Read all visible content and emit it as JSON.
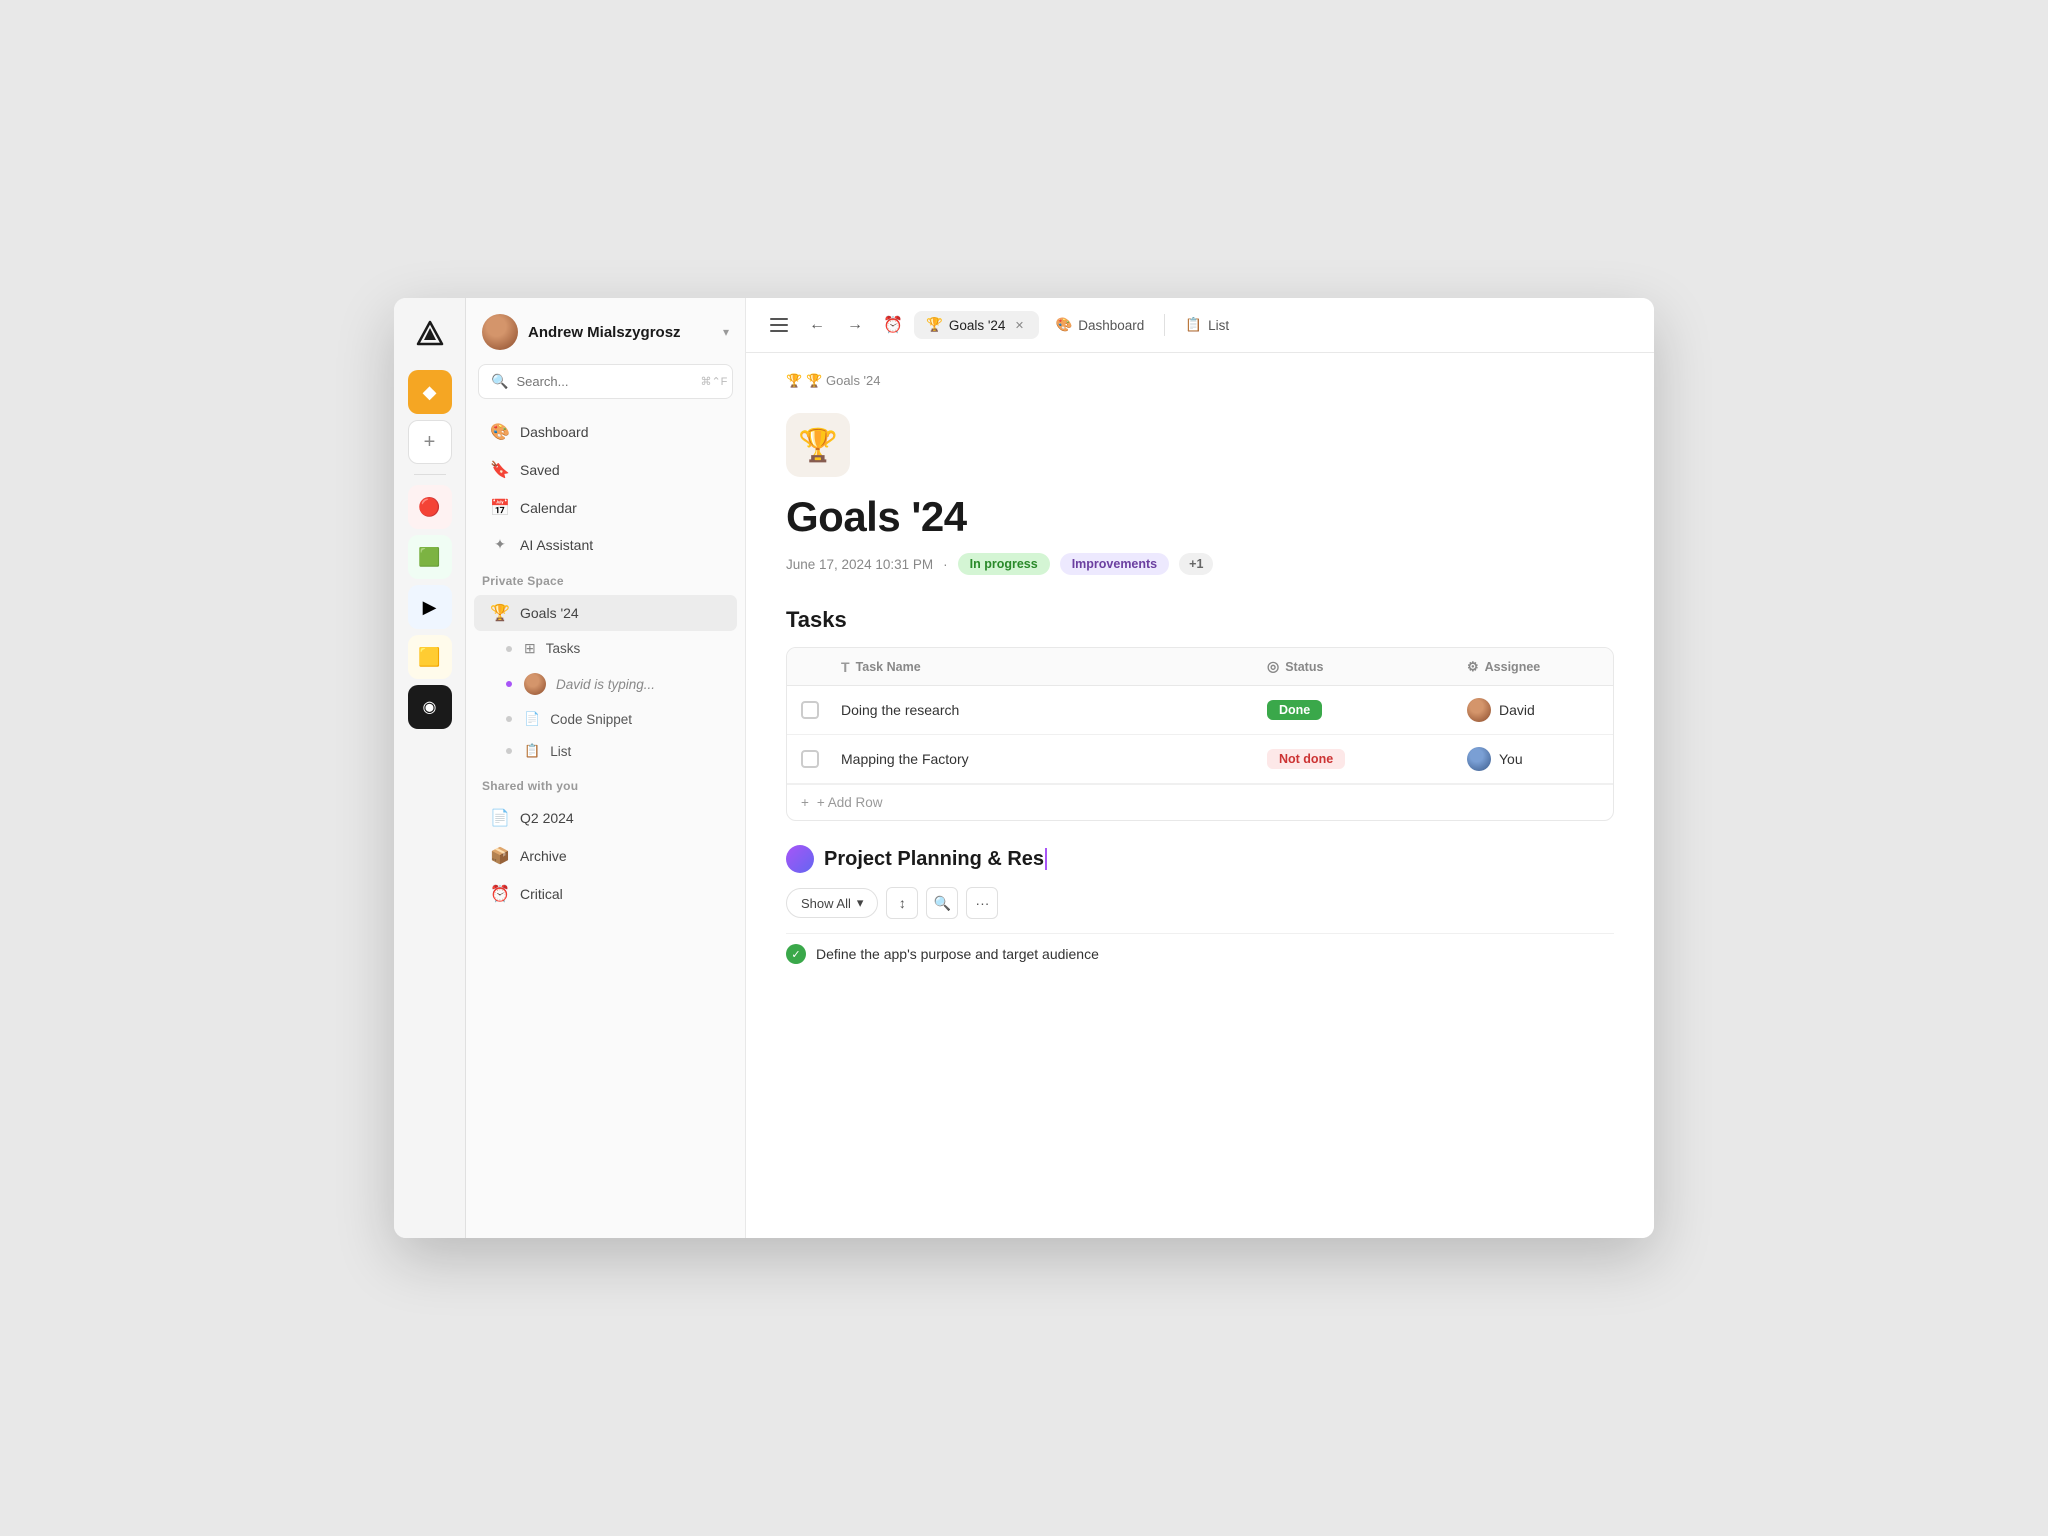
{
  "window": {
    "title": "Goals '24"
  },
  "rail": {
    "logo_label": "App Logo",
    "add_label": "+",
    "workspaces": [
      {
        "id": "ws1",
        "icon": "◆",
        "color": "#f5a623",
        "active": true
      },
      {
        "id": "ws2",
        "icon": "●",
        "color": "#ef4444"
      },
      {
        "id": "ws3",
        "icon": "▣",
        "color": "#22c55e"
      },
      {
        "id": "ws4",
        "icon": "▶",
        "color": "#3b82f6"
      },
      {
        "id": "ws5",
        "icon": "◆",
        "color": "#f59e0b"
      },
      {
        "id": "ws6",
        "icon": "◉",
        "color": "#1a1a1a"
      }
    ]
  },
  "sidebar": {
    "user": {
      "name": "Andrew Mialszygrosz",
      "chevron": "▾"
    },
    "search": {
      "placeholder": "Search...",
      "shortcut": "⌘⌃F"
    },
    "nav": [
      {
        "id": "dashboard",
        "icon": "🎨",
        "label": "Dashboard"
      },
      {
        "id": "saved",
        "icon": "🔖",
        "label": "Saved"
      },
      {
        "id": "calendar",
        "icon": "📅",
        "label": "Calendar"
      },
      {
        "id": "ai",
        "icon": "✦",
        "label": "AI Assistant"
      }
    ],
    "private_space_label": "Private Space",
    "private_items": [
      {
        "id": "goals",
        "icon": "🏆",
        "label": "Goals '24",
        "active": true
      }
    ],
    "sub_items": [
      {
        "id": "tasks",
        "icon": "⊞",
        "label": "Tasks",
        "dot_color": "grey"
      },
      {
        "id": "typing",
        "label": "David is typing...",
        "dot_color": "purple",
        "typing": true
      },
      {
        "id": "snippet",
        "icon": "📄",
        "label": "Code Snippet",
        "dot_color": "grey"
      },
      {
        "id": "list",
        "icon": "📋",
        "label": "List",
        "dot_color": "grey"
      }
    ],
    "shared_label": "Shared with you",
    "shared_items": [
      {
        "id": "q2",
        "icon": "📄",
        "label": "Q2 2024"
      },
      {
        "id": "archive",
        "icon": "📦",
        "label": "Archive"
      },
      {
        "id": "critical",
        "icon": "⏰",
        "label": "Critical"
      }
    ]
  },
  "toolbar": {
    "sidebar_toggle": "sidebar",
    "back": "←",
    "forward": "→",
    "reminder_icon": "⏰",
    "tabs": [
      {
        "id": "goals",
        "icon": "🏆",
        "label": "Goals '24",
        "active": true,
        "closable": true
      },
      {
        "id": "dashboard",
        "icon": "🎨",
        "label": "Dashboard",
        "active": false
      },
      {
        "id": "list",
        "icon": "📋",
        "label": "List",
        "active": false
      }
    ]
  },
  "page": {
    "breadcrumb": "🏆  Goals '24",
    "icon": "🏆",
    "title": "Goals '24",
    "meta": {
      "date": "June 17, 2024 10:31 PM",
      "dot": "·",
      "badges": [
        {
          "id": "in-progress",
          "label": "In progress",
          "type": "green"
        },
        {
          "id": "improvements",
          "label": "Improvements",
          "type": "purple"
        },
        {
          "id": "more",
          "label": "+1"
        }
      ]
    }
  },
  "tasks_section": {
    "title": "Tasks",
    "columns": [
      {
        "id": "checkbox",
        "label": ""
      },
      {
        "id": "task-name",
        "icon": "T",
        "label": "Task Name"
      },
      {
        "id": "status",
        "icon": "◎",
        "label": "Status"
      },
      {
        "id": "assignee",
        "icon": "⚙",
        "label": "Assignee"
      }
    ],
    "rows": [
      {
        "id": "row1",
        "task": "Doing the research",
        "status": "Done",
        "status_type": "done",
        "assignee": "David",
        "avatar_type": "david"
      },
      {
        "id": "row2",
        "task": "Mapping the Factory",
        "status": "Not done",
        "status_type": "notdone",
        "assignee": "You",
        "avatar_type": "you"
      }
    ],
    "add_row_label": "+ Add Row"
  },
  "project_section": {
    "title": "Project Planning & Res",
    "show_all_label": "Show All",
    "filter_icon": "↕",
    "search_icon": "🔍",
    "more_icon": "···",
    "task_preview": {
      "label": "Define the app's purpose and target audience"
    }
  }
}
